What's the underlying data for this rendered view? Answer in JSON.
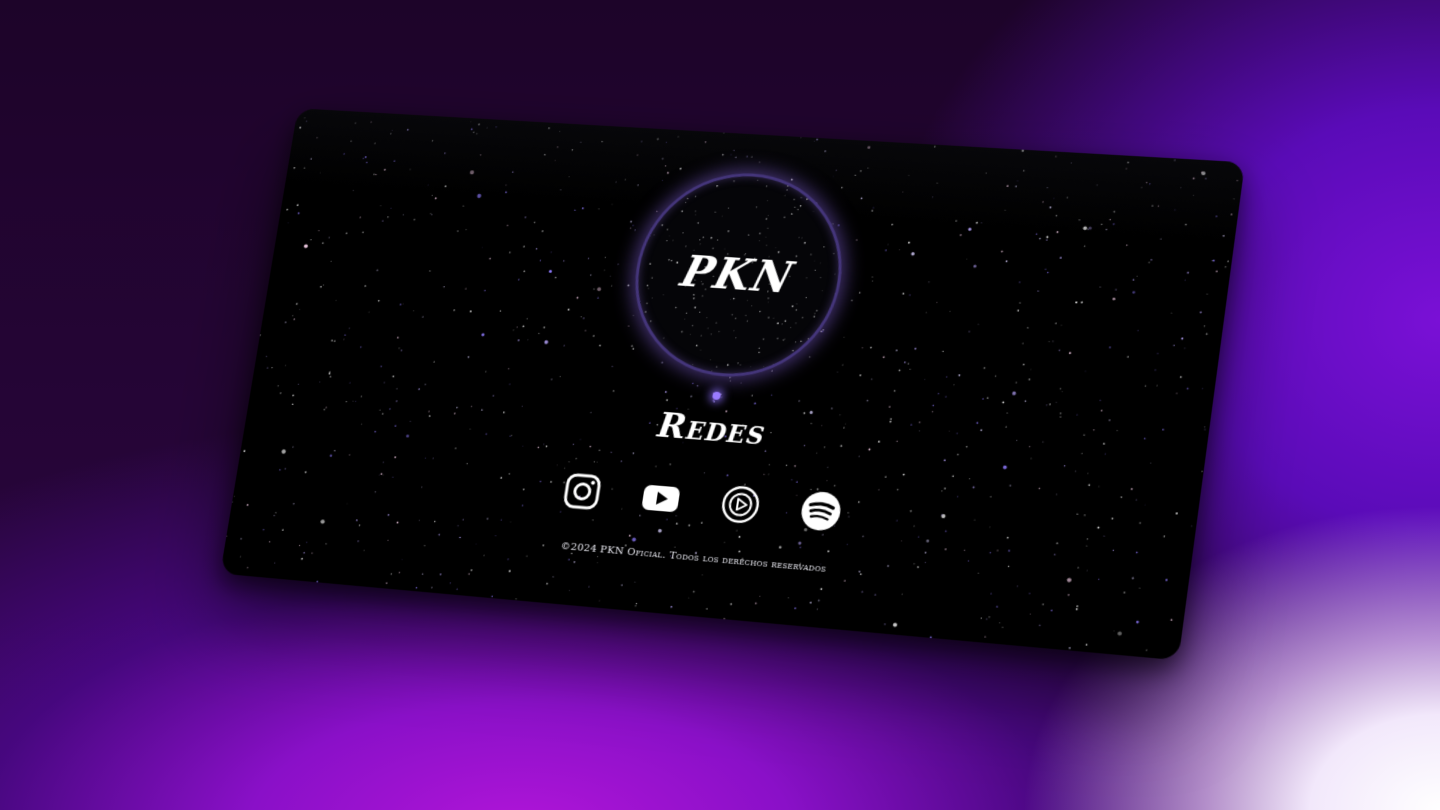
{
  "brand": {
    "logo_text": "PKN"
  },
  "section": {
    "title": "Redes"
  },
  "social": [
    {
      "icon": "instagram-icon"
    },
    {
      "icon": "youtube-icon"
    },
    {
      "icon": "youtube-music-icon"
    },
    {
      "icon": "spotify-icon"
    }
  ],
  "footer": {
    "copyright": "©2024 PKN Oficial. Todos los derechos reservados"
  },
  "colors": {
    "card_bg": "#000000",
    "accent_glow": "#9a7bff",
    "text": "#ffffff"
  }
}
